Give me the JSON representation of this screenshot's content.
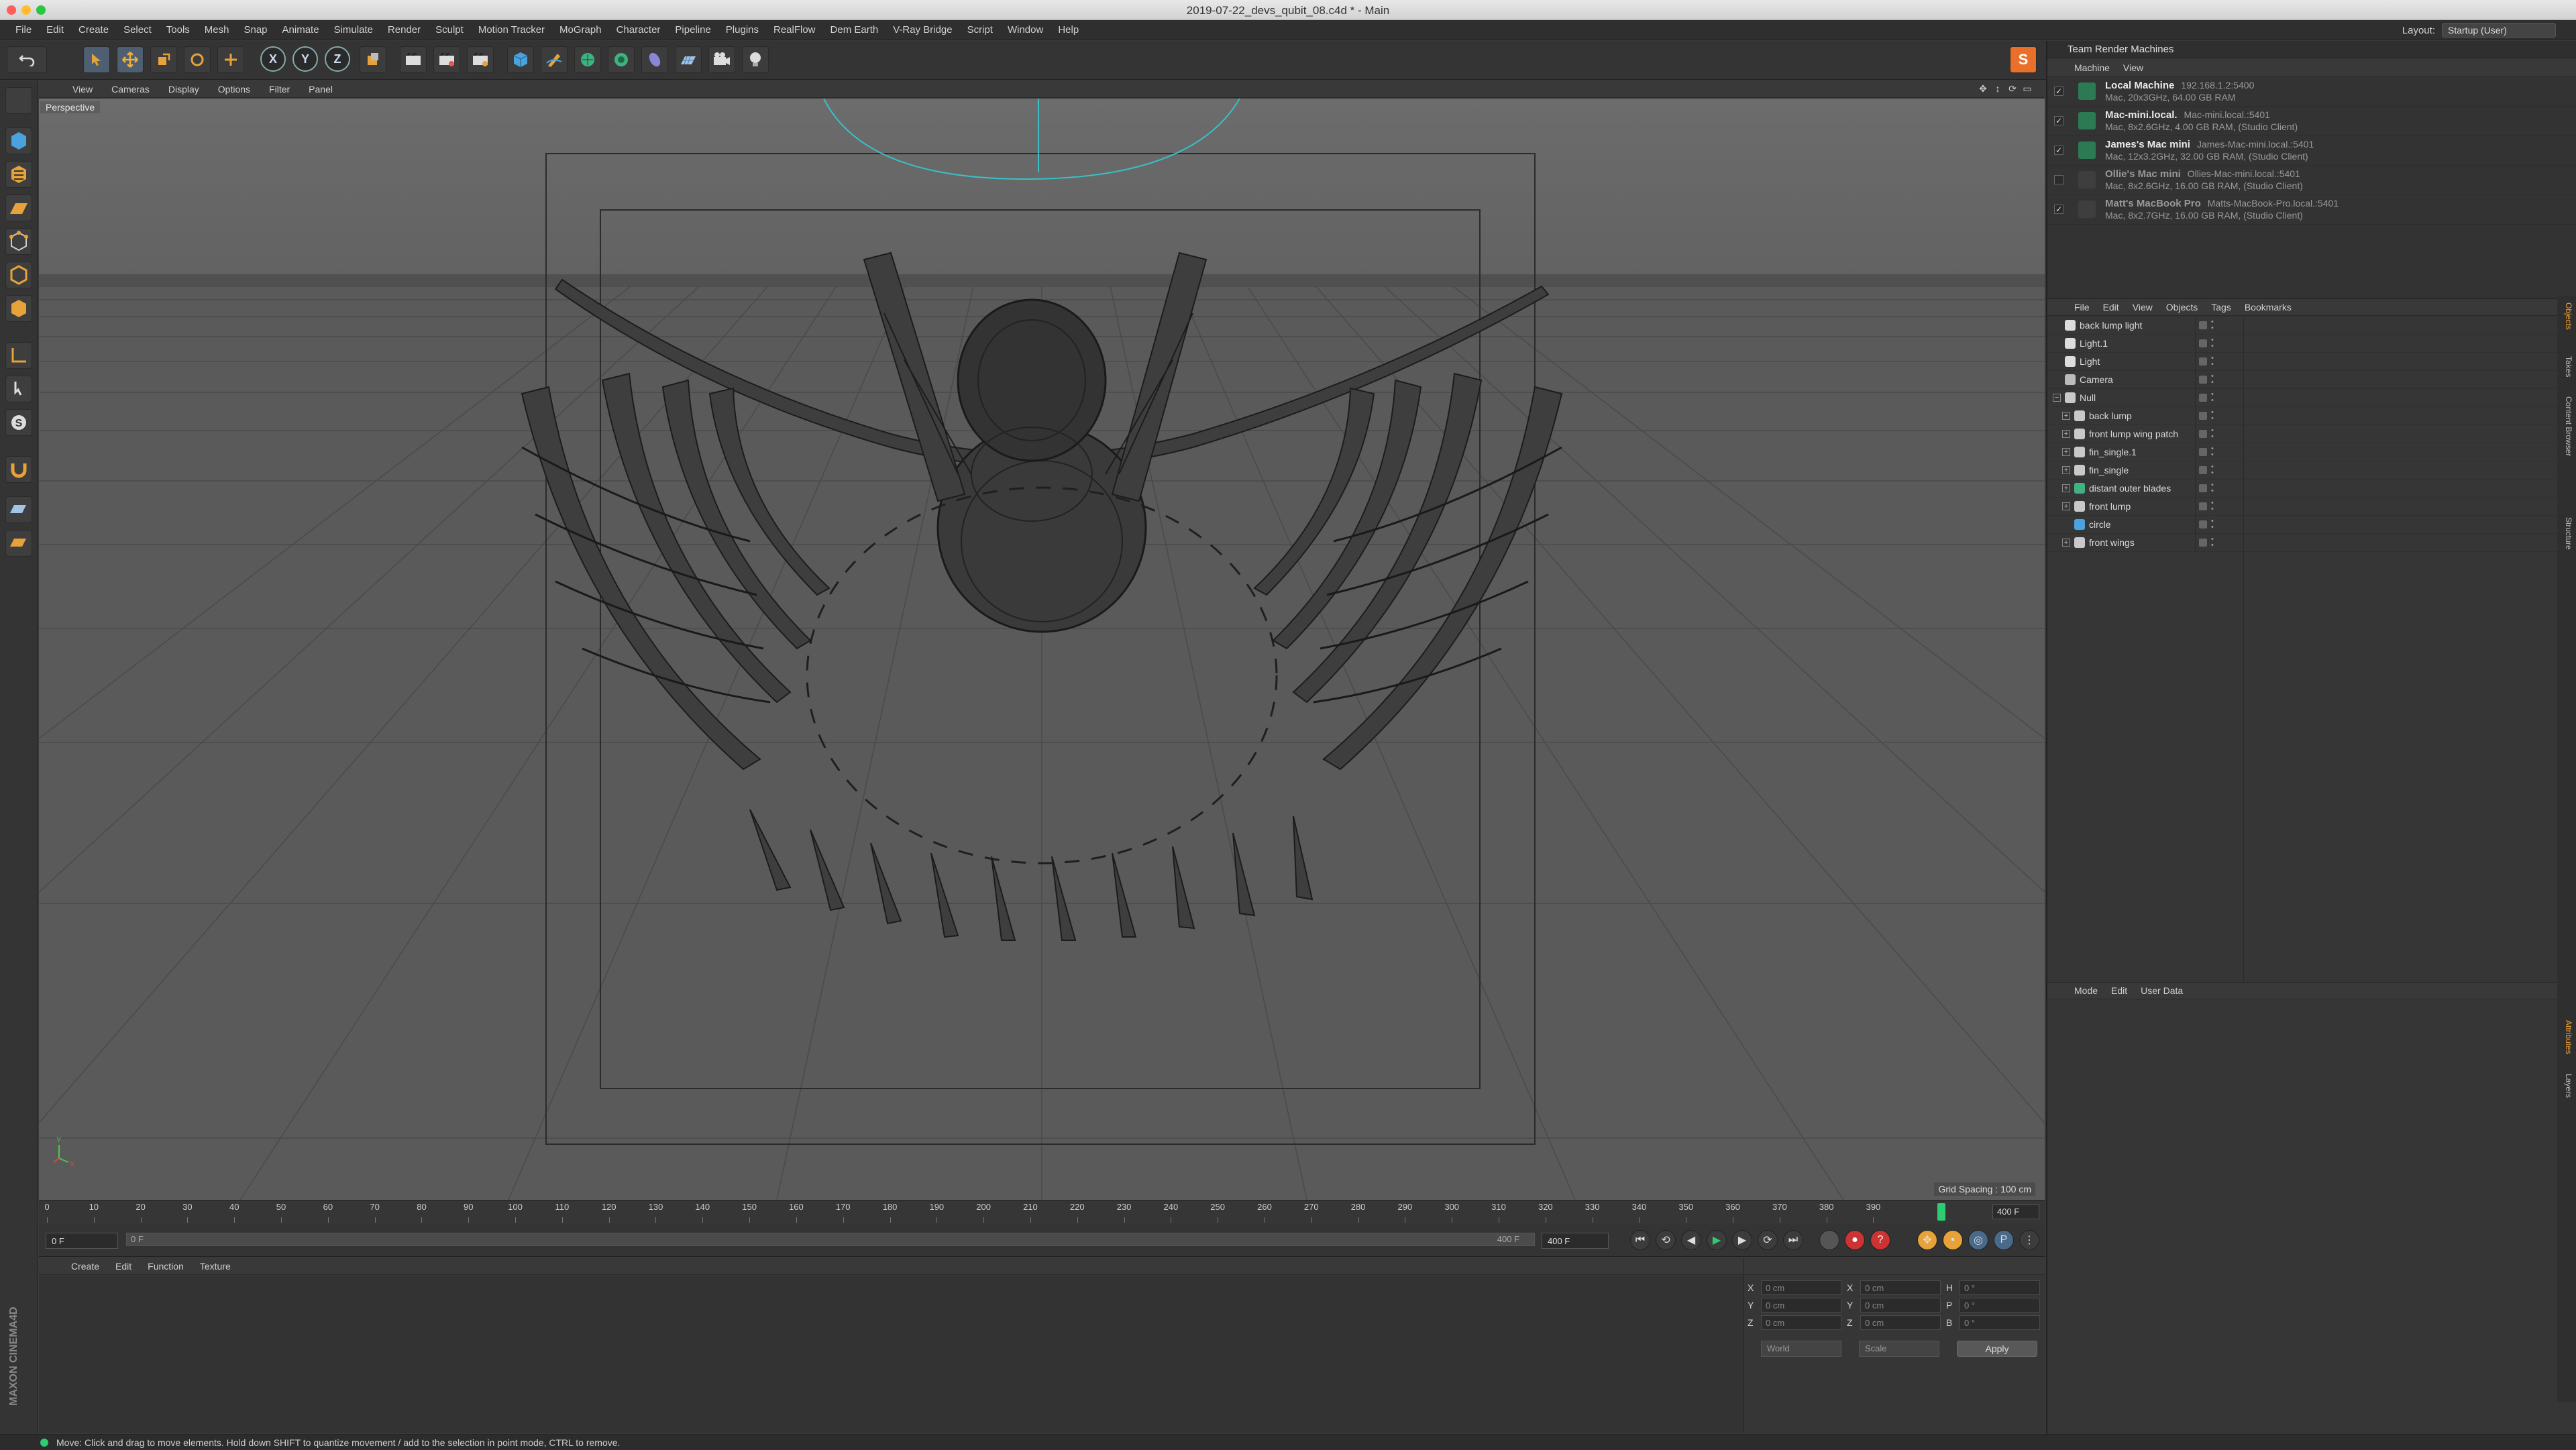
{
  "window": {
    "title": "2019-07-22_devs_qubit_08.c4d * - Main"
  },
  "menubar": {
    "items": [
      "File",
      "Edit",
      "Create",
      "Select",
      "Tools",
      "Mesh",
      "Snap",
      "Animate",
      "Simulate",
      "Render",
      "Sculpt",
      "Motion Tracker",
      "MoGraph",
      "Character",
      "Pipeline",
      "Plugins",
      "RealFlow",
      "Dem Earth",
      "V-Ray Bridge",
      "Script",
      "Window",
      "Help"
    ],
    "layout_label": "Layout:",
    "layout_value": "Startup (User)"
  },
  "toolbar": {
    "axis_x": "X",
    "axis_y": "Y",
    "axis_z": "Z",
    "icons": [
      "undo-icon",
      "move-icon",
      "scale-icon",
      "rotate-icon",
      "create-icon",
      "coord-system-icon",
      "render-view-icon",
      "render-icon",
      "render-settings-icon",
      "cube-icon",
      "pen-icon",
      "subdivision-icon",
      "array-icon",
      "deformer-icon",
      "floor-icon",
      "camera-icon",
      "light-icon"
    ]
  },
  "viewport": {
    "menu": [
      "View",
      "Cameras",
      "Display",
      "Options",
      "Filter",
      "Panel"
    ],
    "label": "Perspective",
    "grid_spacing": "Grid Spacing : 100 cm"
  },
  "timeline": {
    "ticks": [
      "0",
      "10",
      "20",
      "30",
      "40",
      "50",
      "60",
      "70",
      "80",
      "90",
      "100",
      "110",
      "120",
      "130",
      "140",
      "150",
      "160",
      "170",
      "180",
      "190",
      "200",
      "210",
      "220",
      "230",
      "240",
      "250",
      "260",
      "270",
      "280",
      "290",
      "300",
      "310",
      "320",
      "330",
      "340",
      "350",
      "360",
      "370",
      "380",
      "390"
    ],
    "end_frame": "400 F",
    "current_frame_fraction": 0.975
  },
  "transport": {
    "current": "0 F",
    "range_start": "0 F",
    "range_end": "400 F",
    "max": "400 F"
  },
  "material_manager": {
    "menu": [
      "Create",
      "Edit",
      "Function",
      "Texture"
    ]
  },
  "coordinates": {
    "rows": [
      {
        "k1": "X",
        "v1": "0 cm",
        "k2": "X",
        "v2": "0 cm",
        "k3": "H",
        "v3": "0 °"
      },
      {
        "k1": "Y",
        "v1": "0 cm",
        "k2": "Y",
        "v2": "0 cm",
        "k3": "P",
        "v3": "0 °"
      },
      {
        "k1": "Z",
        "v1": "0 cm",
        "k2": "Z",
        "v2": "0 cm",
        "k3": "B",
        "v3": "0 °"
      }
    ],
    "mode_select": "World",
    "scale_select": "Scale",
    "apply_label": "Apply"
  },
  "status": {
    "text": "Move: Click and drag to move elements. Hold down SHIFT to quantize movement / add to the selection in point mode, CTRL to remove."
  },
  "team_render": {
    "title": "Team Render Machines",
    "menu": [
      "Machine",
      "View"
    ],
    "machines": [
      {
        "name": "Local Machine",
        "addr": "192.168.1.2:5400",
        "spec": "Mac, 20x3GHz, 64.00 GB RAM",
        "checked": "✓",
        "active": true
      },
      {
        "name": "Mac-mini.local.",
        "addr": "Mac-mini.local.:5401",
        "spec": "Mac, 8x2.6GHz, 4.00 GB RAM, (Studio Client)",
        "checked": "✓",
        "active": true
      },
      {
        "name": "James's Mac mini",
        "addr": "James-Mac-mini.local.:5401",
        "spec": "Mac, 12x3.2GHz, 32.00 GB RAM, (Studio Client)",
        "checked": "✓",
        "active": true
      },
      {
        "name": "Ollie's Mac mini",
        "addr": "Ollies-Mac-mini.local.:5401",
        "spec": "Mac, 8x2.6GHz, 16.00 GB RAM, (Studio Client)",
        "checked": "",
        "active": false
      },
      {
        "name": "Matt's MacBook Pro",
        "addr": "Matts-MacBook-Pro.local.:5401",
        "spec": "Mac, 8x2.7GHz, 16.00 GB RAM, (Studio Client)",
        "checked": "✓",
        "active": false
      }
    ]
  },
  "object_manager": {
    "menu": [
      "File",
      "Edit",
      "View",
      "Objects",
      "Tags",
      "Bookmarks"
    ],
    "objects": [
      {
        "name": "back lump light",
        "depth": 0,
        "expander": "",
        "icon_color": "#dddddd"
      },
      {
        "name": "Light.1",
        "depth": 0,
        "expander": "",
        "icon_color": "#dddddd"
      },
      {
        "name": "Light",
        "depth": 0,
        "expander": "",
        "icon_color": "#dddddd"
      },
      {
        "name": "Camera",
        "depth": 0,
        "expander": "",
        "icon_color": "#bbbbbb"
      },
      {
        "name": "Null",
        "depth": 0,
        "expander": "−",
        "icon_color": "#c9c9c9"
      },
      {
        "name": "back lump",
        "depth": 1,
        "expander": "+",
        "icon_color": "#c9c9c9"
      },
      {
        "name": "front lump wing patch",
        "depth": 1,
        "expander": "+",
        "icon_color": "#c9c9c9"
      },
      {
        "name": "fin_single.1",
        "depth": 1,
        "expander": "+",
        "icon_color": "#c9c9c9"
      },
      {
        "name": "fin_single",
        "depth": 1,
        "expander": "+",
        "icon_color": "#c9c9c9"
      },
      {
        "name": "distant outer blades",
        "depth": 1,
        "expander": "+",
        "icon_color": "#3fb37f"
      },
      {
        "name": "front lump",
        "depth": 1,
        "expander": "+",
        "icon_color": "#c9c9c9"
      },
      {
        "name": "circle",
        "depth": 1,
        "expander": "",
        "icon_color": "#4aa3df"
      },
      {
        "name": "front wings",
        "depth": 1,
        "expander": "+",
        "icon_color": "#c9c9c9"
      }
    ]
  },
  "attribute_manager": {
    "menu": [
      "Mode",
      "Edit",
      "User Data"
    ]
  },
  "side_tabs": [
    "Objects",
    "Takes",
    "Content Browser",
    "Structure",
    "Attributes",
    "Layers"
  ]
}
